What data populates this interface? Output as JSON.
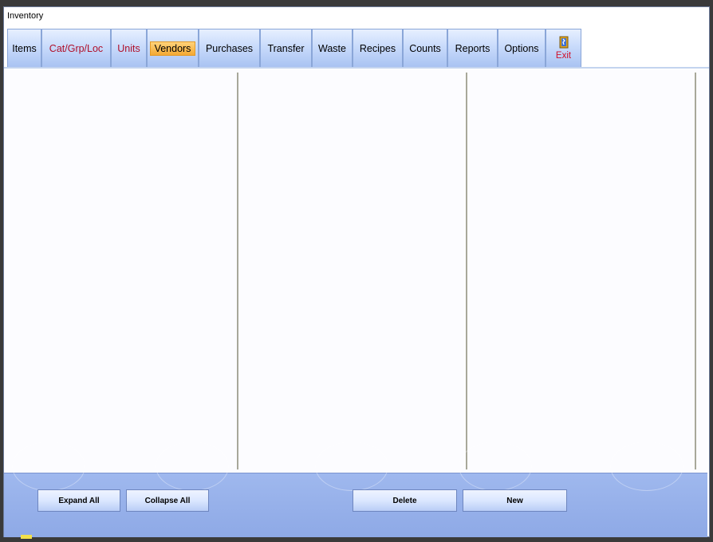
{
  "window": {
    "title": "Inventory"
  },
  "tabs": [
    {
      "label": "Items",
      "color": "#000000"
    },
    {
      "label": "Cat/Grp/Loc",
      "color": "#b0102a"
    },
    {
      "label": "Units",
      "color": "#b0102a"
    },
    {
      "label": "Vendors",
      "active": true
    },
    {
      "label": "Purchases"
    },
    {
      "label": "Transfer"
    },
    {
      "label": "Waste"
    },
    {
      "label": "Recipes"
    },
    {
      "label": "Counts"
    },
    {
      "label": "Reports"
    },
    {
      "label": "Options"
    },
    {
      "label": "Exit",
      "icon": "exit-door-icon"
    }
  ],
  "footer": {
    "expand_all": "Expand All",
    "collapse_all": "Collapse All",
    "delete": "Delete",
    "new": "New"
  },
  "colors": {
    "accent_active_tab": "#f4a933",
    "footer_bg": "#9fb8ee"
  }
}
